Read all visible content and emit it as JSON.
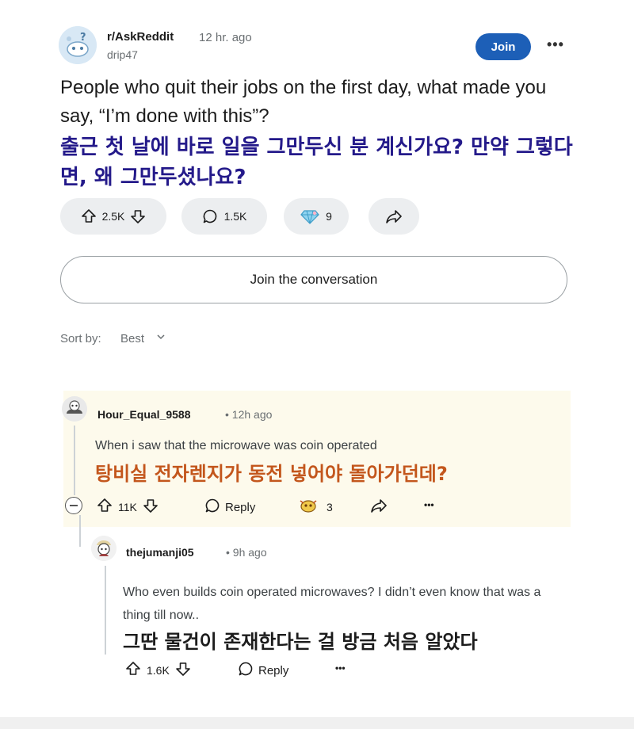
{
  "post": {
    "subreddit": "r/AskReddit",
    "time": "12 hr. ago",
    "author": "drip47",
    "join_label": "Join",
    "more_label": "•••",
    "title_en": "People who quit their jobs on the first day, what made you say, “I’m done with this”?",
    "title_ko": "출근 첫 날에 바로 일을 그만두신 분 계신가요? 만약 그렇다면, 왜 그만두셨나요?",
    "votes": "2.5K",
    "comments": "1.5K",
    "awards": "9",
    "accent_color": "#1d5fb7",
    "korean_title_color": "#241a8a"
  },
  "join_conversation_label": "Join the conversation",
  "sort": {
    "label": "Sort by:",
    "value": "Best"
  },
  "comments": [
    {
      "user": "Hour_Equal_9588",
      "time": "• 12h ago",
      "text_en": "When i saw that the microwave was coin operated",
      "text_ko": "탕비실 전자렌지가 동전 넣어야 돌아가던데?",
      "votes": "11K",
      "reply_label": "Reply",
      "awards": "3",
      "more_label": "•••",
      "highlight_bg": "#fdfaec",
      "korean_color": "#c3561c"
    },
    {
      "user": "thejumanji05",
      "time": "• 9h ago",
      "text_en": "Who even builds coin operated microwaves? I didn’t even know that was a thing till now..",
      "text_ko": "그딴 물건이 존재한다는 걸 방금 처음 알았다",
      "votes": "1.6K",
      "reply_label": "Reply",
      "more_label": "•••"
    }
  ]
}
